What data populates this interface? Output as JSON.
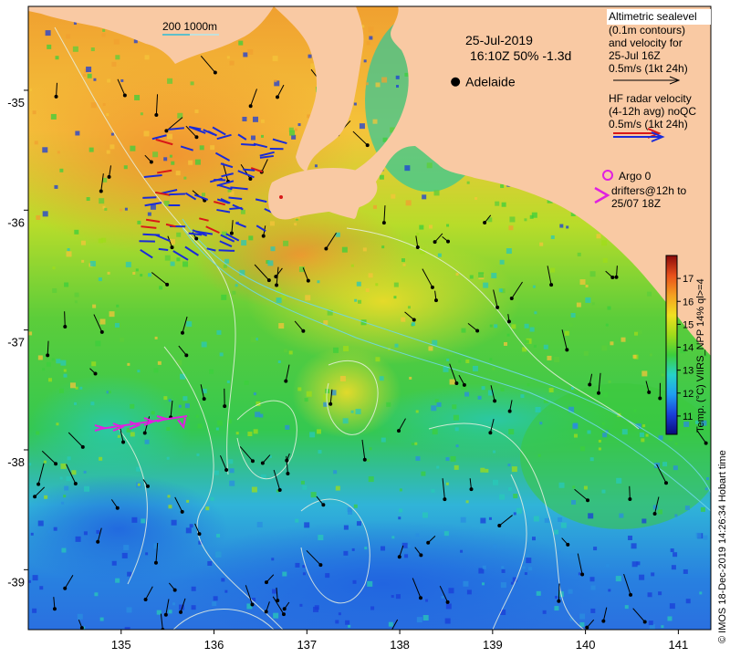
{
  "map": {
    "date": "25-Jul-2019",
    "time_line": "16:10Z  50% -1.3d",
    "scale_label": "200  1000m",
    "city": {
      "name": "Adelaide",
      "lon": 138.6,
      "lat": -34.93
    },
    "x_ticks": [
      "135",
      "136",
      "137",
      "138",
      "139",
      "140",
      "141"
    ],
    "y_ticks": [
      "-35",
      "-36",
      "-37",
      "-38",
      "-39"
    ],
    "lon_range": [
      134.0,
      141.35
    ],
    "lat_range": [
      -39.5,
      -34.3
    ]
  },
  "legend": {
    "alt_lines": [
      "Altimetric sealevel",
      "(0.1m contours)",
      "and velocity for",
      "25-Jul 16Z",
      "0.5m/s (1kt 24h)"
    ],
    "hf_lines": [
      "HF radar velocity",
      "(4-12h avg) noQC",
      "0.5m/s (1kt 24h)"
    ],
    "argo": "Argo 0",
    "drifter_lines": [
      "drifters@12h to",
      "25/07 18Z"
    ]
  },
  "colorbar": {
    "label": "Temp. (°C) VIIRS_NPP 14% ql>=4",
    "ticks": [
      "11",
      "12",
      "13",
      "14",
      "15",
      "16",
      "17"
    ],
    "range": [
      10.2,
      18.0
    ]
  },
  "credit": "© IMOS 18-Dec-2019 14:26:34 Hobart time",
  "colors": {
    "land": "#f9c9a3",
    "hf_red": "#d81818",
    "hf_blue": "#1a2bd8",
    "drifter": "#e020e0",
    "colorbar_stops": [
      "#0a0a7a",
      "#1a3ed8",
      "#1f9ef0",
      "#26d2c8",
      "#3ccf3c",
      "#9fdc1a",
      "#f0e020",
      "#f5a020",
      "#e8501a",
      "#8a0a0a"
    ]
  }
}
